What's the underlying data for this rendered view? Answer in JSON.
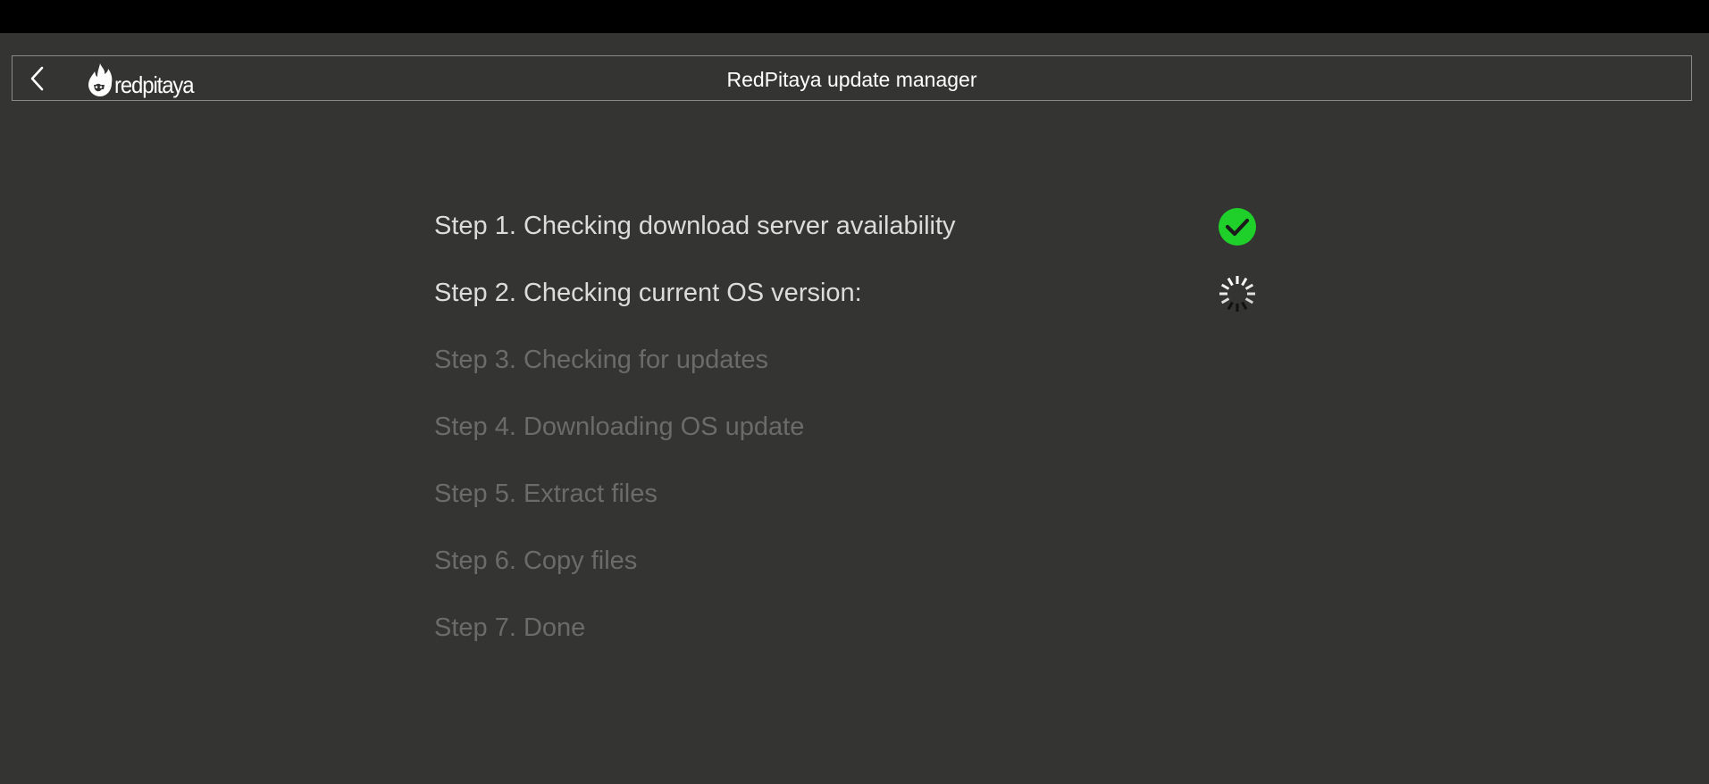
{
  "header": {
    "title": "RedPitaya update manager",
    "logo_text": "redpitaya",
    "back_icon": "chevron-left-icon",
    "logo_icon": "redpitaya-flame-icon"
  },
  "steps": [
    {
      "label": "Step 1. Checking download server availability",
      "state": "done",
      "status_icon": "check-circle-icon"
    },
    {
      "label": "Step 2. Checking current OS version:",
      "state": "in-progress",
      "status_icon": "spinner-icon"
    },
    {
      "label": "Step 3. Checking for updates",
      "state": "pending"
    },
    {
      "label": "Step 4. Downloading OS update",
      "state": "pending"
    },
    {
      "label": "Step 5. Extract files",
      "state": "pending"
    },
    {
      "label": "Step 6. Copy files",
      "state": "pending"
    },
    {
      "label": "Step 7. Done",
      "state": "pending"
    }
  ],
  "colors": {
    "background": "#343432",
    "topbar": "#000000",
    "active_text": "#dcdcda",
    "pending_text": "#6b6b69",
    "success": "#1fcf2a"
  }
}
